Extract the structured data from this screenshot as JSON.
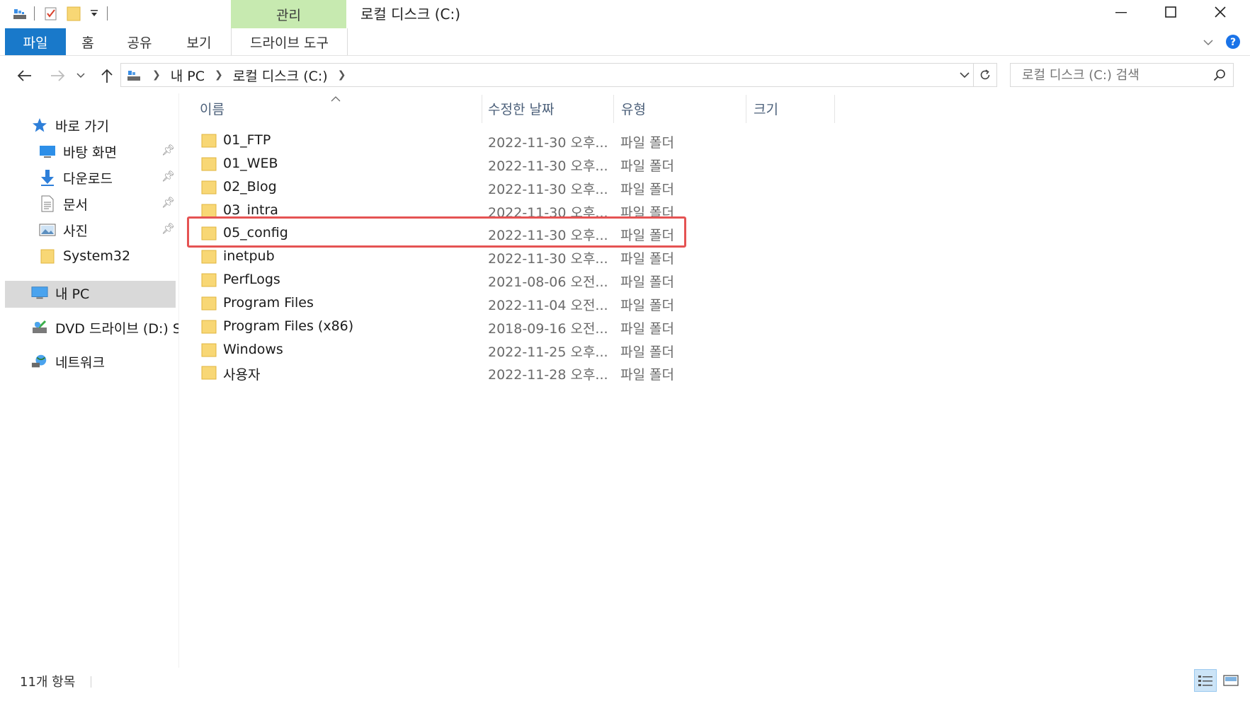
{
  "titlebar": {
    "manage_tab": "관리",
    "title": "로컬 디스크 (C:)"
  },
  "ribbon": {
    "tabs": [
      {
        "label": "파일"
      },
      {
        "label": "홈"
      },
      {
        "label": "공유"
      },
      {
        "label": "보기"
      },
      {
        "label": "드라이브 도구"
      }
    ]
  },
  "address": {
    "crumbs": [
      "내 PC",
      "로컬 디스크 (C:)"
    ],
    "search_placeholder": "로컬 디스크 (C:) 검색"
  },
  "sidebar": {
    "quick_access": "바로 가기",
    "items": [
      {
        "label": "바탕 화면",
        "icon": "desktop-icon",
        "pinned": true
      },
      {
        "label": "다운로드",
        "icon": "download-icon",
        "pinned": true
      },
      {
        "label": "문서",
        "icon": "document-icon",
        "pinned": true
      },
      {
        "label": "사진",
        "icon": "pictures-icon",
        "pinned": true
      },
      {
        "label": "System32",
        "icon": "folder-icon",
        "pinned": false
      }
    ],
    "this_pc": "내 PC",
    "dvd": "DVD 드라이브 (D:) S",
    "network": "네트워크"
  },
  "columns": {
    "name": "이름",
    "date": "수정한 날짜",
    "type": "유형",
    "size": "크기"
  },
  "files": [
    {
      "name": "01_FTP",
      "date": "2022-11-30 오후...",
      "type": "파일 폴더"
    },
    {
      "name": "01_WEB",
      "date": "2022-11-30 오후...",
      "type": "파일 폴더"
    },
    {
      "name": "02_Blog",
      "date": "2022-11-30 오후...",
      "type": "파일 폴더"
    },
    {
      "name": "03_intra",
      "date": "2022-11-30 오후...",
      "type": "파일 폴더"
    },
    {
      "name": "05_config",
      "date": "2022-11-30 오후...",
      "type": "파일 폴더",
      "highlighted": true
    },
    {
      "name": "inetpub",
      "date": "2022-11-30 오후...",
      "type": "파일 폴더"
    },
    {
      "name": "PerfLogs",
      "date": "2021-08-06 오전...",
      "type": "파일 폴더"
    },
    {
      "name": "Program Files",
      "date": "2022-11-04 오전...",
      "type": "파일 폴더"
    },
    {
      "name": "Program Files (x86)",
      "date": "2018-09-16 오전...",
      "type": "파일 폴더"
    },
    {
      "name": "Windows",
      "date": "2022-11-25 오후...",
      "type": "파일 폴더"
    },
    {
      "name": "사용자",
      "date": "2022-11-28 오후...",
      "type": "파일 폴더"
    }
  ],
  "status": {
    "count": "11개 항목"
  },
  "colors": {
    "file_tab": "#1979ca",
    "manage_tab": "#c7eab0",
    "highlight": "#e55353",
    "selected_nav": "#d9d9d9"
  }
}
